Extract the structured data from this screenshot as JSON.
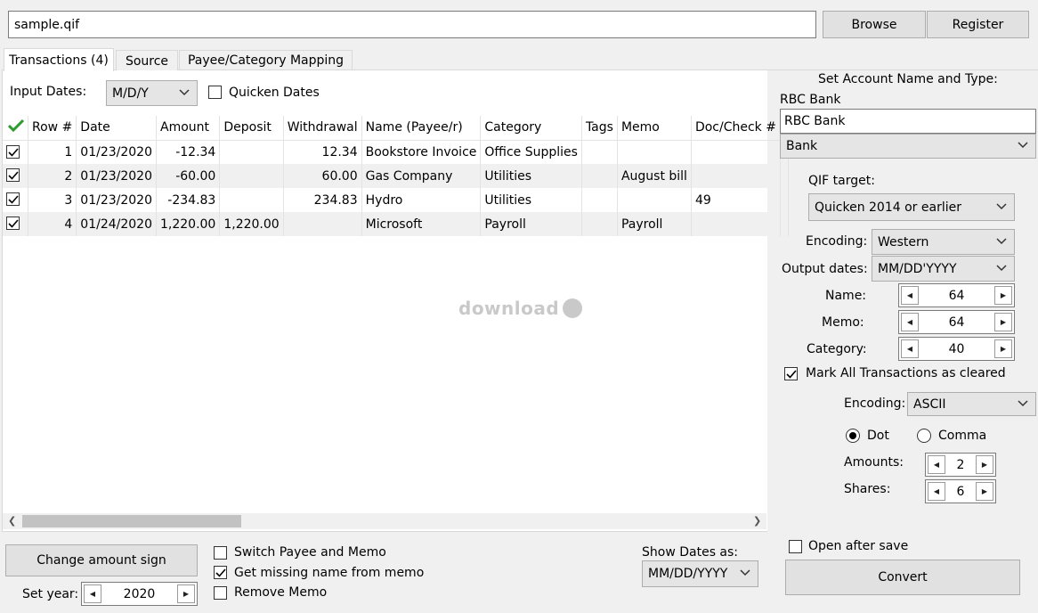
{
  "file": {
    "path": "sample.qif",
    "browse_label": "Browse",
    "register_label": "Register"
  },
  "tabs": [
    {
      "label": "Transactions (4)"
    },
    {
      "label": "Source"
    },
    {
      "label": "Payee/Category Mapping"
    }
  ],
  "input_dates": {
    "label": "Input Dates:",
    "value": "M/D/Y",
    "quicken_dates_label": "Quicken Dates"
  },
  "grid": {
    "columns": [
      "Row #",
      "Date",
      "Amount",
      "Deposit",
      "Withdrawal",
      "Name (Payee/r)",
      "Category",
      "Tags",
      "Memo",
      "Doc/Check #"
    ],
    "rows": [
      {
        "row": "1",
        "date": "01/23/2020",
        "amount": "-12.34",
        "deposit": "",
        "withdrawal": "12.34",
        "name": "Bookstore Invoice",
        "category": "Office Supplies",
        "tags": "",
        "memo": "",
        "doc": ""
      },
      {
        "row": "2",
        "date": "01/23/2020",
        "amount": "-60.00",
        "deposit": "",
        "withdrawal": "60.00",
        "name": "Gas Company",
        "category": "Utilities",
        "tags": "",
        "memo": "August bill",
        "doc": ""
      },
      {
        "row": "3",
        "date": "01/23/2020",
        "amount": "-234.83",
        "deposit": "",
        "withdrawal": "234.83",
        "name": "Hydro",
        "category": "Utilities",
        "tags": "",
        "memo": "",
        "doc": "49"
      },
      {
        "row": "4",
        "date": "01/24/2020",
        "amount": "1,220.00",
        "deposit": "1,220.00",
        "withdrawal": "",
        "name": "Microsoft",
        "category": "Payroll",
        "tags": "",
        "memo": "Payroll",
        "doc": ""
      }
    ]
  },
  "watermark": "download",
  "bottom": {
    "change_amount_sign_label": "Change amount sign",
    "set_year_label": "Set year:",
    "set_year_value": "2020",
    "switch_payee_memo_label": "Switch Payee and Memo",
    "get_missing_name_label": "Get missing name from memo",
    "remove_memo_label": "Remove Memo",
    "show_dates_label": "Show Dates as:",
    "show_dates_value": "MM/DD/YYYY"
  },
  "right": {
    "account_heading": "Set Account Name and Type:",
    "account_caption": "RBC Bank",
    "account_name": "RBC Bank",
    "account_type": "Bank",
    "qif_target_label": "QIF target:",
    "qif_target_value": "Quicken 2014 or earlier",
    "encoding_label": "Encoding:",
    "encoding_value": "Western",
    "output_dates_label": "Output dates:",
    "output_dates_value": "MM/DD'YYYY",
    "name_label": "Name:",
    "name_value": "64",
    "memo_label": "Memo:",
    "memo_value": "64",
    "category_label": "Category:",
    "category_value": "40",
    "mark_cleared_label": "Mark All Transactions as cleared",
    "encoding2_label": "Encoding:",
    "encoding2_value": "ASCII",
    "dot_label": "Dot",
    "comma_label": "Comma",
    "amounts_label": "Amounts:",
    "amounts_value": "2",
    "shares_label": "Shares:",
    "shares_value": "6",
    "open_after_save_label": "Open after save",
    "convert_label": "Convert"
  }
}
